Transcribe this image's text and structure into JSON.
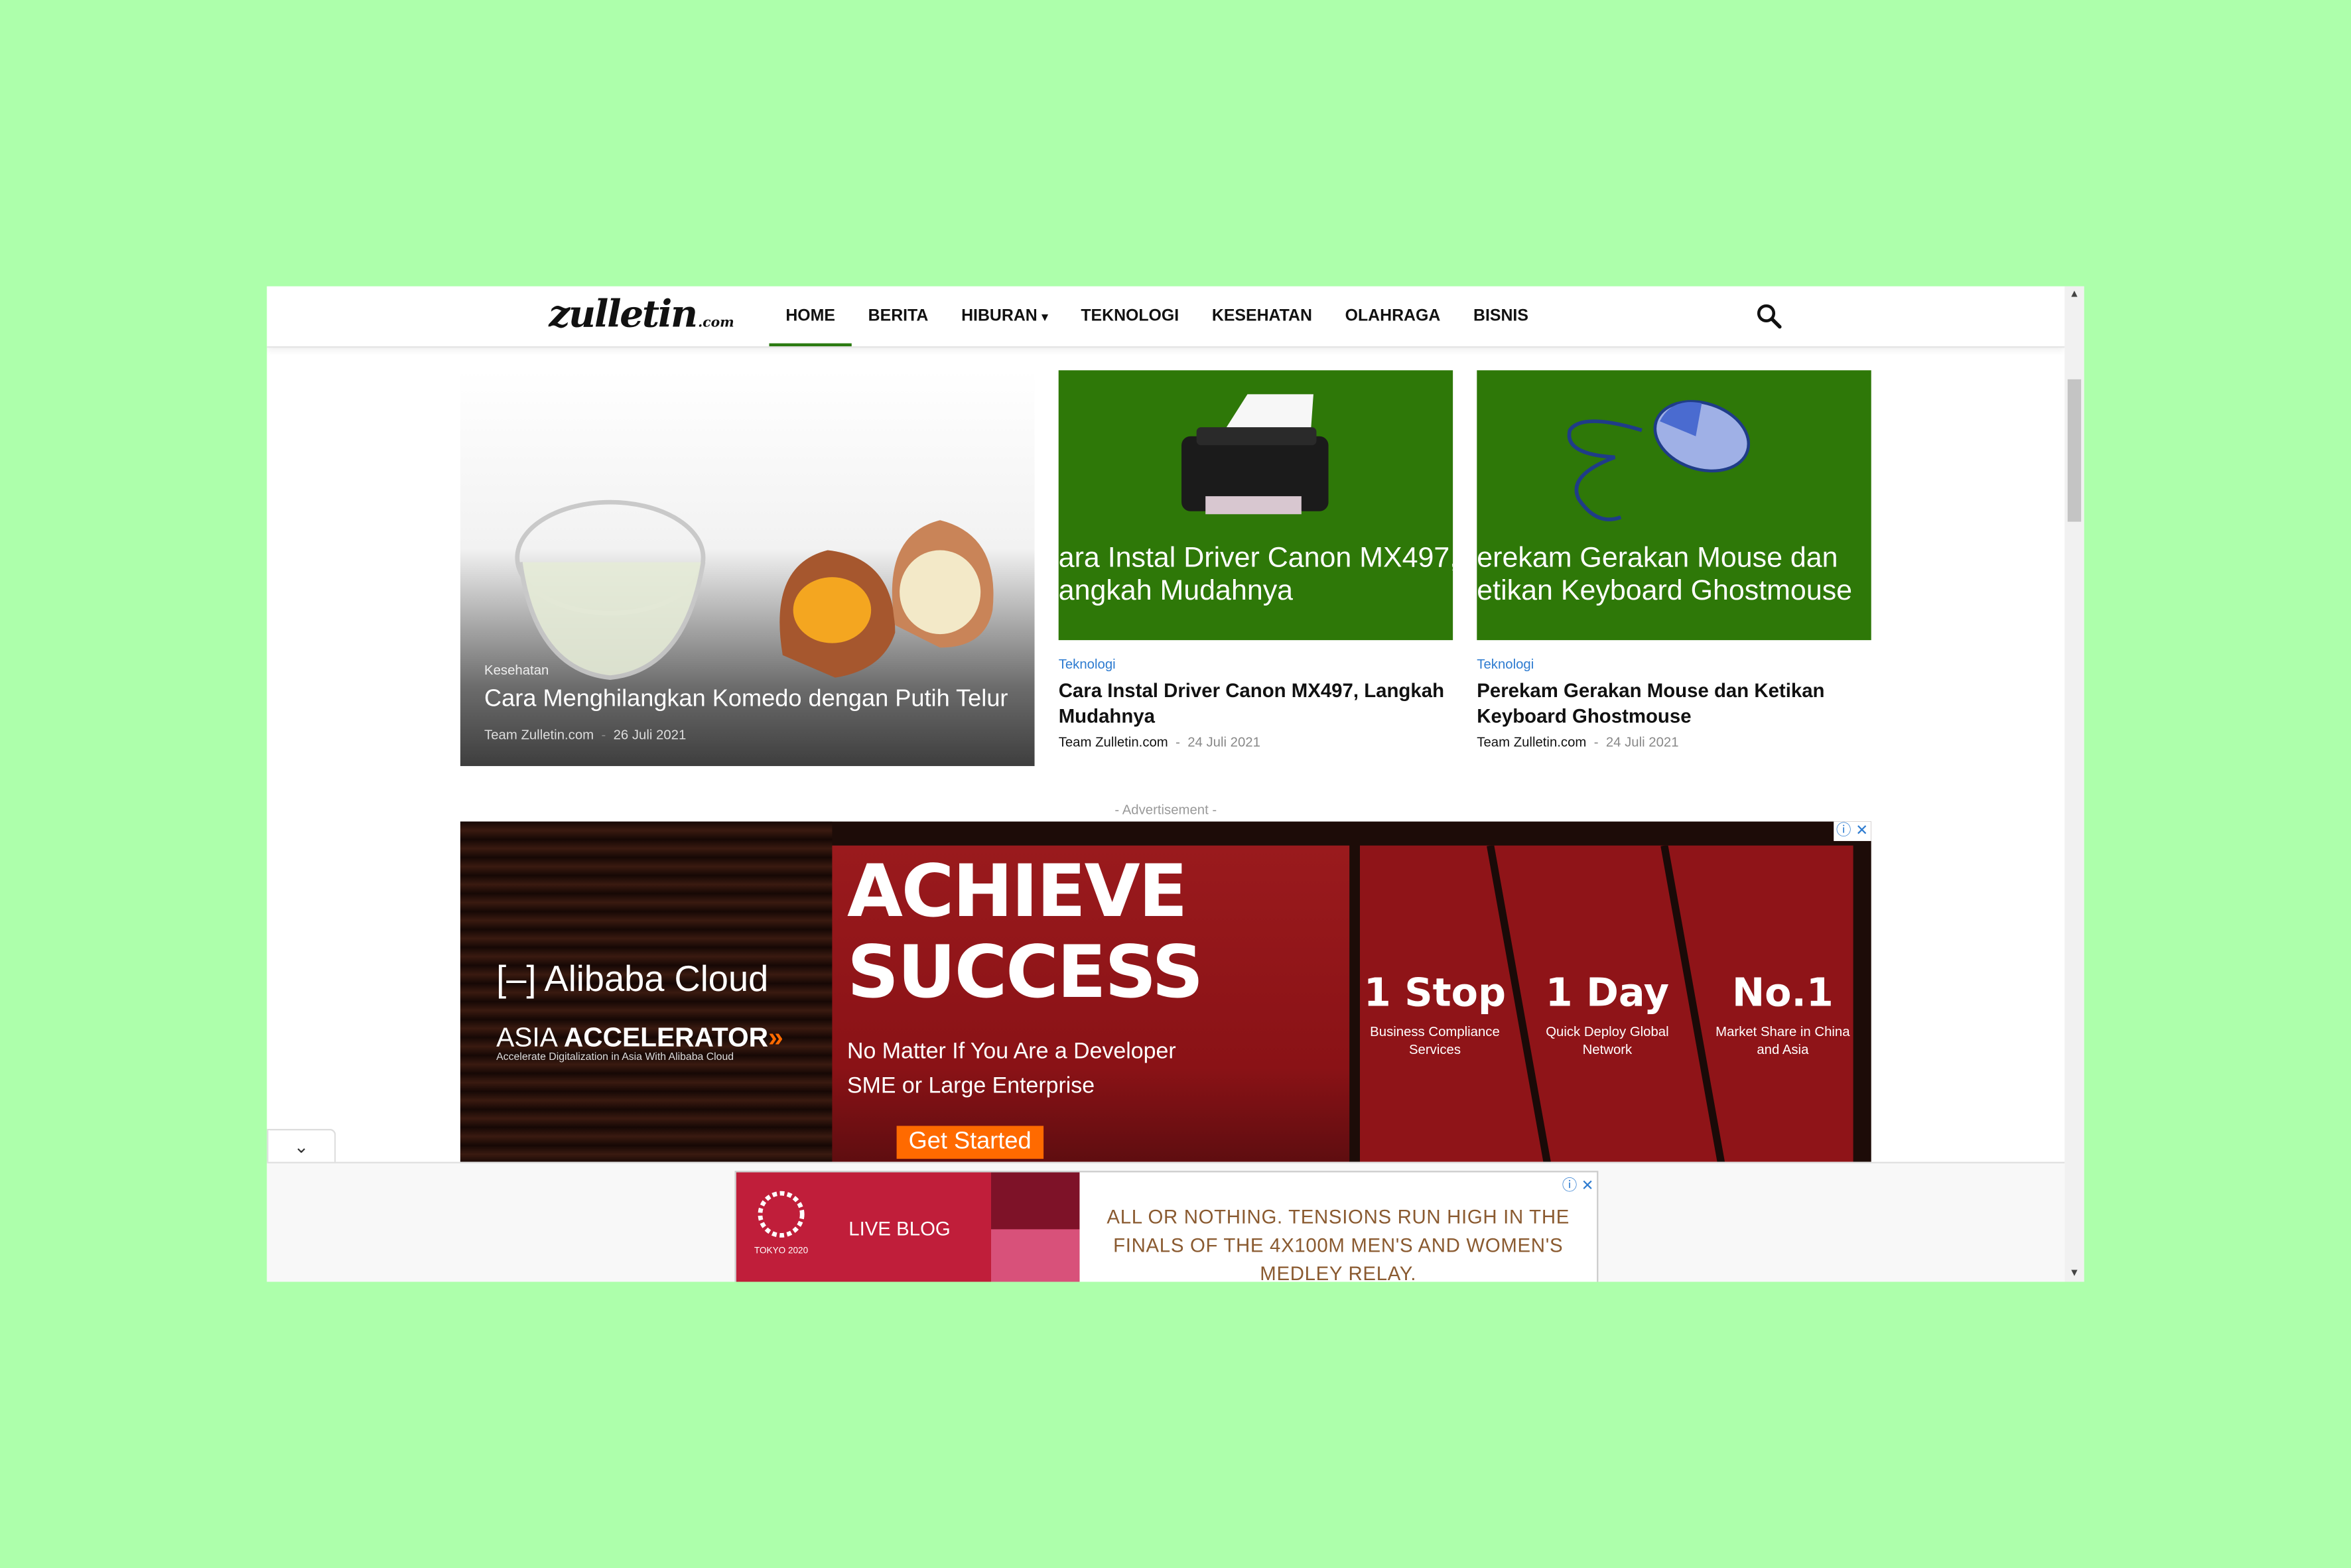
{
  "header": {
    "logo_main": "zulletin",
    "logo_suffix": ".com",
    "nav": [
      "HOME",
      "BERITA",
      "HIBURAN",
      "TEKNOLOGI",
      "KESEHATAN",
      "OLAHRAGA",
      "BISNIS"
    ],
    "caret": "▾",
    "search_icon": "search-icon"
  },
  "featured": {
    "category": "Kesehatan",
    "title": "Cara Menghilangkan Komedo dengan Putih Telur",
    "author": "Team Zulletin.com",
    "separator": "-",
    "date": "26 Juli 2021"
  },
  "cards": [
    {
      "thumb_text": "ara Instal Driver Canon MX497,\nangkah Mudahnya",
      "category": "Teknologi",
      "title": "Cara Instal Driver Canon MX497, Langkah Mudahnya",
      "author": "Team Zulletin.com",
      "separator": "-",
      "date": "24 Juli 2021",
      "icon": "printer-icon"
    },
    {
      "thumb_text": "erekam Gerakan Mouse dan\netikan Keyboard Ghostmouse",
      "category": "Teknologi",
      "title": "Perekam Gerakan Mouse dan Ketikan Keyboard Ghostmouse",
      "author": "Team Zulletin.com",
      "separator": "-",
      "date": "24 Juli 2021",
      "icon": "mouse-icon"
    }
  ],
  "ad_label": "- Advertisement -",
  "ad1": {
    "brand": "Alibaba Cloud",
    "program_prefix": "ASIA ",
    "program": "ACCELERATOR",
    "program_arrow": "»",
    "tagline": "Accelerate Digitalization in Asia With Alibaba Cloud",
    "headline1": "ACHIEVE",
    "headline2": "SUCCESS",
    "sub1": "No Matter If You Are a Developer",
    "sub2": "SME or Large Enterprise",
    "cta": "Get Started",
    "stats": [
      {
        "big": "1 Stop",
        "small": "Business Compliance Services"
      },
      {
        "big": "1 Day",
        "small": "Quick Deploy Global Network"
      },
      {
        "big": "No.1",
        "small": "Market Share in China and Asia"
      }
    ],
    "choice_i": "ⓘ",
    "choice_x": "✕"
  },
  "ad2": {
    "event": "TOKYO 2020",
    "label": "LIVE BLOG",
    "text": "ALL OR NOTHING. TENSIONS RUN HIGH IN THE FINALS OF THE 4X100M MEN'S AND WOMEN'S MEDLEY RELAY.",
    "choice_i": "ⓘ",
    "choice_x": "✕"
  },
  "collapse_icon": "chevron-down-icon",
  "colors": {
    "background": "#adffab",
    "accent": "#2a7a10",
    "thumb_green": "#2e7808",
    "ad_red": "#8f1418",
    "alibaba_orange": "#ff6a00"
  }
}
